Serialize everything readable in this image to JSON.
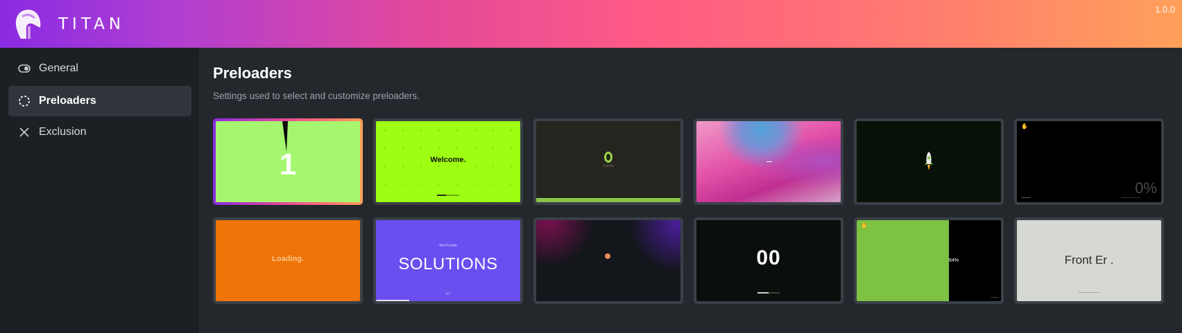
{
  "app": {
    "name": "TITAN",
    "version": "1.0.0"
  },
  "sidebar": {
    "items": [
      {
        "label": "General",
        "icon": "toggle-icon",
        "active": false
      },
      {
        "label": "Preloaders",
        "icon": "spinner-icon",
        "active": true
      },
      {
        "label": "Exclusion",
        "icon": "close-icon",
        "active": false
      }
    ]
  },
  "page": {
    "title": "Preloaders",
    "subtitle": "Settings used to select and customize preloaders."
  },
  "previews": [
    {
      "text": "1",
      "selected": true,
      "bg": "#a6f76f"
    },
    {
      "text": "Welcome.",
      "selected": false,
      "bg": "#9eff12"
    },
    {
      "text": "Gravity",
      "selected": false,
      "bg": "#25241f"
    },
    {
      "text": "",
      "selected": false,
      "bg": "#d63fa0"
    },
    {
      "text": "",
      "selected": false,
      "bg": "#071107"
    },
    {
      "text": "0%",
      "selected": false,
      "bg": "#000000"
    },
    {
      "text": "Loading.",
      "selected": false,
      "bg": "#ef7407"
    },
    {
      "text": "We Provide",
      "text2": "SOLUTIONS",
      "text3": "0/3",
      "selected": false,
      "bg": "#6a4ef0"
    },
    {
      "text": "",
      "selected": false,
      "bg": "#13161b"
    },
    {
      "text": "00",
      "selected": false,
      "bg": "#0b0f0b"
    },
    {
      "text": "64%",
      "selected": false,
      "bg": "#7dc242"
    },
    {
      "text": "Front Er .",
      "selected": false,
      "bg": "#d6d8d3"
    }
  ],
  "colors": {
    "accent_start": "#8a2be2",
    "accent_end": "#ffa05a"
  }
}
